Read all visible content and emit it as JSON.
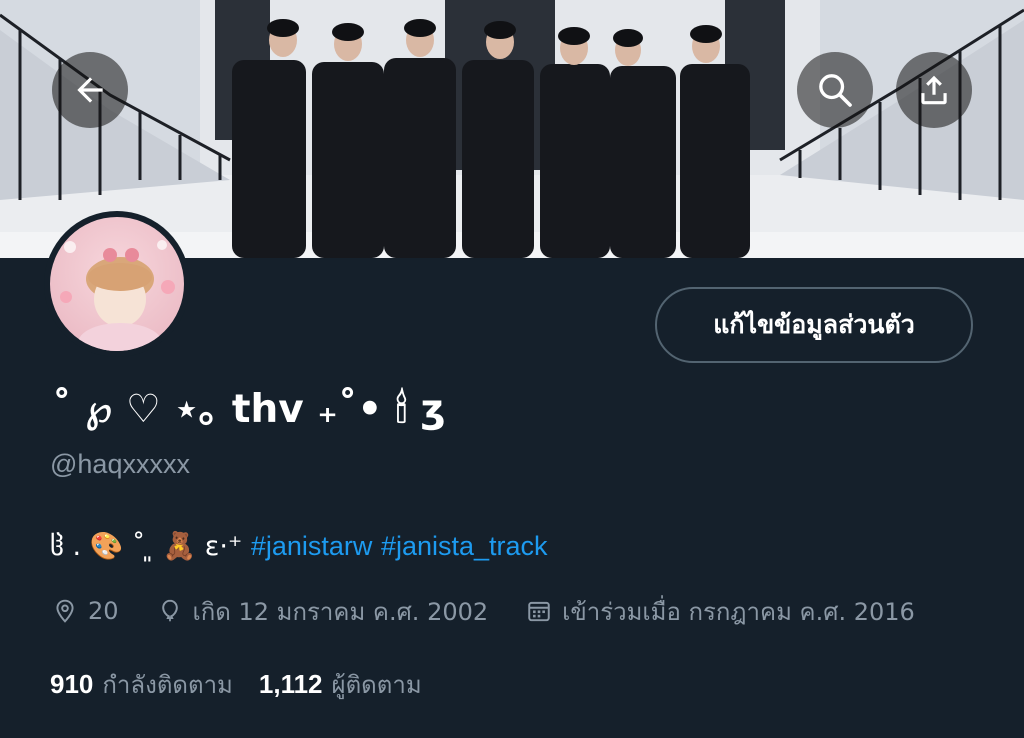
{
  "header": {
    "back_icon": "arrow-left-icon",
    "search_icon": "search-icon",
    "share_icon": "share-upload-icon"
  },
  "profile": {
    "display_name": "˚ ℘ ♡ ⋆｡ thv ₊˚• 🕯 ʒ",
    "handle": "@haqxxxxx",
    "edit_button_label": "แก้ไขข้อมูลส่วนตัว",
    "bio_prefix": "ჱ . 🎨 ˚ ͈ 🧸 ɛ·⁺",
    "bio_hashtags": [
      "#janistarw",
      "#janista_track"
    ],
    "location": "20",
    "birthday": "เกิด 12 มกราคม ค.ศ. 2002",
    "joined": "เข้าร่วมเมื่อ กรกฎาคม ค.ศ. 2016"
  },
  "stats": {
    "following_count": "910",
    "following_label": "กำลังติดตาม",
    "followers_count": "1,112",
    "followers_label": "ผู้ติดตาม"
  },
  "colors": {
    "background": "#15202b",
    "secondary_text": "#8b98a5",
    "link": "#1d9bf0",
    "border": "#536471"
  }
}
